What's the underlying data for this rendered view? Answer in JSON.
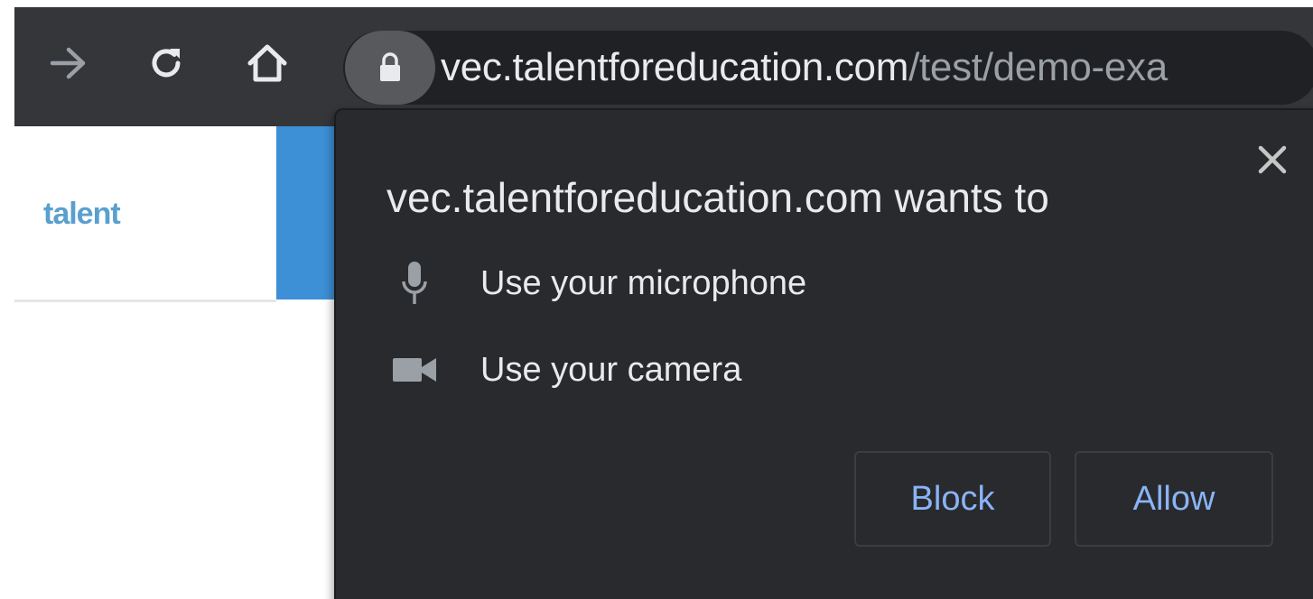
{
  "browser": {
    "url_host": "vec.talentforeducation.com",
    "url_path": "/test/demo-exa",
    "icons": {
      "forward": "forward-arrow-icon",
      "reload": "reload-icon",
      "home": "home-icon",
      "lock": "lock-icon"
    }
  },
  "page": {
    "brand_text": "talent",
    "accent_color": "#3d8fd6"
  },
  "permission_prompt": {
    "title": "vec.talentforeducation.com wants to",
    "permissions": [
      {
        "icon": "microphone-icon",
        "label": "Use your microphone"
      },
      {
        "icon": "camera-icon",
        "label": "Use your camera"
      }
    ],
    "block_label": "Block",
    "allow_label": "Allow",
    "close_icon": "close-icon",
    "button_text_color": "#8ab4f8"
  }
}
